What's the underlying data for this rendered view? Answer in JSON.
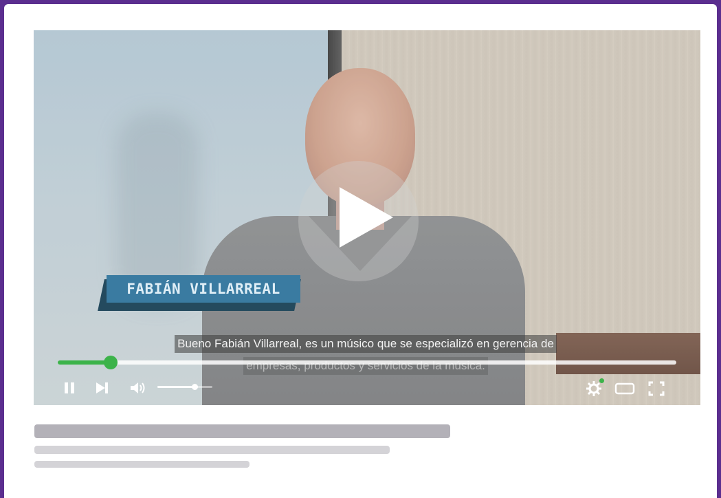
{
  "video": {
    "name_plate": "FABIÁN VILLARREAL",
    "subtitle_line1": "Bueno Fabián Villarreal, es un músico que se especializó en gerencia de",
    "subtitle_line2": "empresas, productos y servicios de la música.",
    "progress": 0.085,
    "volume": 0.68,
    "state": "paused"
  },
  "icons": {
    "play": "play-icon",
    "pause": "pause-icon",
    "next": "skip-next-icon",
    "volume": "volume-icon",
    "settings": "gear-icon",
    "theater": "theater-mode-icon",
    "fullscreen": "fullscreen-icon"
  },
  "colors": {
    "frame": "#5b2e8f",
    "accent": "#3cb34a",
    "name_plate": "#3a7ba1",
    "placeholder_dark": "#b3b1b8",
    "placeholder_light": "#d4d3d7"
  },
  "placeholders": [
    {
      "level": "title"
    },
    {
      "level": "line"
    },
    {
      "level": "short-line"
    }
  ]
}
